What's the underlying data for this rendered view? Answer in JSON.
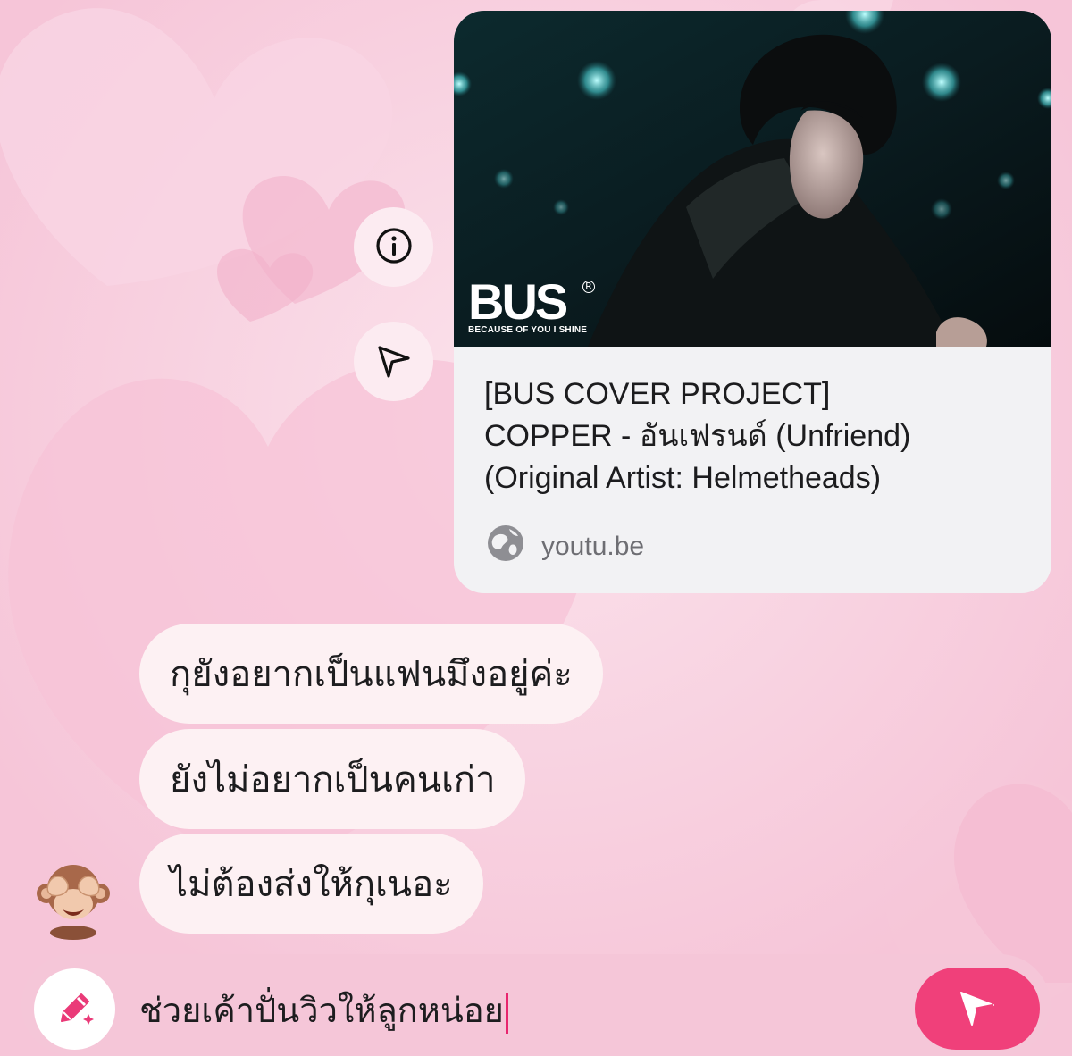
{
  "link_preview": {
    "title_lines": [
      "[BUS COVER PROJECT]",
      "COPPER - อันเฟรนด์ (Unfriend)",
      "(Original Artist: Helmetheads)"
    ],
    "domain": "youtu.be",
    "thumbnail": {
      "logo_text": "BUS",
      "logo_tagline": "BECAUSE OF YOU I SHINE"
    }
  },
  "side_actions": [
    {
      "icon": "info-icon"
    },
    {
      "icon": "share-send-icon"
    }
  ],
  "messages": [
    {
      "text": "กุยังอยากเป็นแฟนมึงอยู่ค่ะ"
    },
    {
      "text": "ยังไม่อยากเป็นคนเก่า"
    },
    {
      "text": "ไม่ต้องส่งให้กุเนอะ"
    }
  ],
  "sender_avatar": "see-no-evil-monkey-emoji",
  "composer": {
    "value": "ช่วยเค้าปั่นวิวให้ลูกหน่อย",
    "left_icon": "pencil-sparkle-icon",
    "send_icon": "send-icon"
  },
  "colors": {
    "background": "#f8d2e2",
    "accent": "#f0407a",
    "bubble": "#fdf1f3",
    "card": "#f2f2f4"
  }
}
